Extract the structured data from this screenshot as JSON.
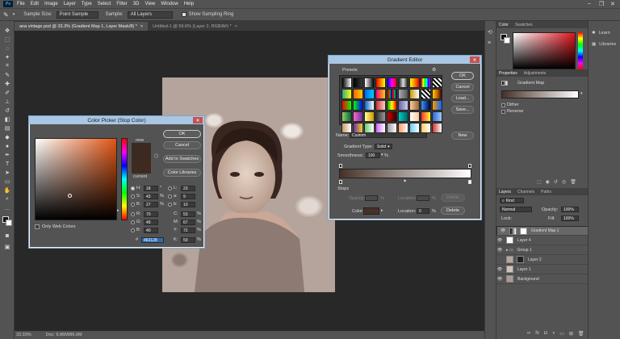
{
  "app": {
    "logo": "Ps"
  },
  "menu": [
    "File",
    "Edit",
    "Image",
    "Layer",
    "Type",
    "Select",
    "Filter",
    "3D",
    "View",
    "Window",
    "Help"
  ],
  "window_controls": [
    "–",
    "❐",
    "✕"
  ],
  "options_bar": {
    "sample_size_label": "Sample Size:",
    "sample_size_value": "Point Sample",
    "sample_label": "Sample:",
    "sample_value": "All Layers",
    "show_ring_label": "Show Sampling Ring"
  },
  "tabs": [
    {
      "label": "ana vintage.psd @ 33.3% (Gradient Map 1, Layer Mask/8) *",
      "active": true
    },
    {
      "label": "Untitled-1 @ 59.6% (Layer 2, RGB/8#) *",
      "active": false
    }
  ],
  "tab_close": "×",
  "status": {
    "zoom": "33.33%",
    "doc": "Doc: 6.86M/86.6M"
  },
  "color_picker": {
    "title": "Color Picker (Stop Color)",
    "ok": "OK",
    "cancel": "Cancel",
    "add_swatches": "Add to Swatches",
    "color_libraries": "Color Libraries",
    "new_label": "new",
    "current_label": "current",
    "only_web_colors": "Only Web Colors",
    "new_color": "#3a2a22",
    "current_color": "#3f2a21",
    "hue_color": "#e25514",
    "fields_left": [
      {
        "label": "H:",
        "value": "18",
        "unit": "°"
      },
      {
        "label": "S:",
        "value": "43",
        "unit": "%"
      },
      {
        "label": "B:",
        "value": "27",
        "unit": "%"
      },
      {
        "label": "R:",
        "value": "70",
        "unit": ""
      },
      {
        "label": "G:",
        "value": "49",
        "unit": ""
      },
      {
        "label": "B:",
        "value": "40",
        "unit": ""
      }
    ],
    "fields_right": [
      {
        "label": "L:",
        "value": "23",
        "unit": ""
      },
      {
        "label": "a:",
        "value": "9",
        "unit": ""
      },
      {
        "label": "b:",
        "value": "10",
        "unit": ""
      },
      {
        "label": "C:",
        "value": "53",
        "unit": "%"
      },
      {
        "label": "M:",
        "value": "67",
        "unit": "%"
      },
      {
        "label": "Y:",
        "value": "72",
        "unit": "%"
      },
      {
        "label": "K:",
        "value": "59",
        "unit": "%"
      }
    ],
    "hex_label": "#",
    "hex": "463128"
  },
  "gradient_editor": {
    "title": "Gradient Editor",
    "presets_label": "Presets",
    "ok": "OK",
    "cancel": "Cancel",
    "load": "Load...",
    "save": "Save...",
    "name_label": "Name:",
    "name_value": "Custom",
    "new_button": "New",
    "type_label": "Gradient Type:",
    "type_value": "Solid",
    "smoothness_label": "Smoothness:",
    "smoothness_value": "100",
    "smoothness_unit": "%",
    "stops_label": "Stops",
    "opacity_label": "Opacity:",
    "opacity_unit": "%",
    "location_label": "Location:",
    "location_unit": "%",
    "delete_label": "Delete",
    "color_label": "Color:",
    "color_swatch": "#463128",
    "location2_label": "Location:",
    "location2_value": "0",
    "location2_unit": "%",
    "delete2_label": "Delete",
    "gradient_start": "#463128",
    "gradient_end": "#ffffff"
  },
  "color_panel": {
    "tabs": [
      "Color",
      "Swatches"
    ],
    "hue_color": "#e0141e"
  },
  "properties_panel": {
    "tabs": [
      "Properties",
      "Adjustments"
    ],
    "type": "Gradient Map",
    "dither": "Dither",
    "reverse": "Reverse"
  },
  "layers_panel": {
    "tabs": [
      "Layers",
      "Channels",
      "Paths"
    ],
    "kind_label": "Kind",
    "blend_mode": "Normal",
    "opacity_label": "Opacity:",
    "opacity_value": "100%",
    "lock_label": "Lock:",
    "fill_label": "Fill:",
    "fill_value": "100%",
    "layers": [
      {
        "name": "Gradient Map 1",
        "selected": true
      },
      {
        "name": "Layer 4",
        "selected": false
      },
      {
        "name": "Group 1",
        "selected": false
      },
      {
        "name": "Layer 2",
        "selected": false
      },
      {
        "name": "Layer 1",
        "selected": false
      },
      {
        "name": "Background",
        "selected": false
      }
    ],
    "footer_icons": [
      "link-icon",
      "fx-icon",
      "mask-icon",
      "adjustment-icon",
      "folder-icon",
      "new-layer-icon",
      "trash-icon"
    ]
  },
  "right_col": {
    "items": [
      "Learn",
      "Libraries"
    ]
  }
}
